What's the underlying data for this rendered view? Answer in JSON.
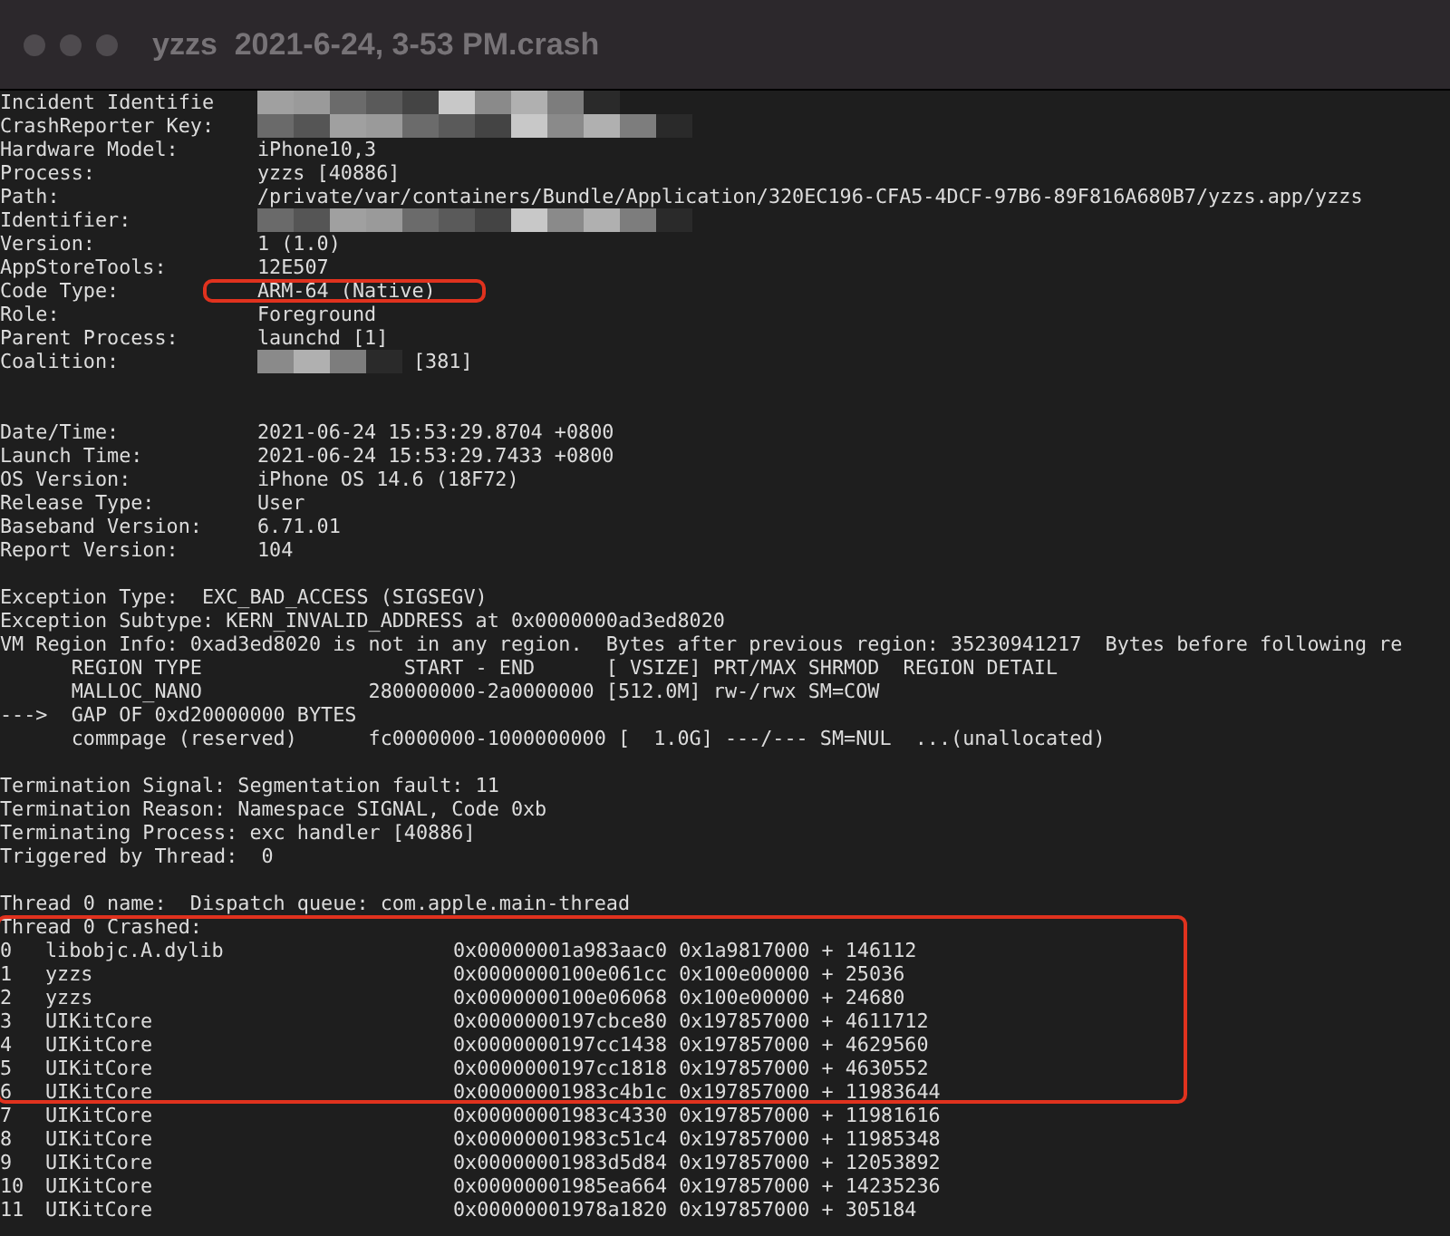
{
  "window": {
    "title": "yzzs  2021-6-24, 3-53 PM.crash"
  },
  "header_fields": [
    {
      "label": "Incident Identifie",
      "redacted": true,
      "highlighted": false
    },
    {
      "label": "CrashReporter Key:",
      "redacted": true,
      "highlighted": false
    },
    {
      "label": "Hardware Model:",
      "value": "iPhone10,3",
      "redacted": false,
      "highlighted": false
    },
    {
      "label": "Process:",
      "value": "yzzs [40886]",
      "redacted": false,
      "highlighted": false
    },
    {
      "label": "Path:",
      "value": "/private/var/containers/Bundle/Application/320EC196-CFA5-4DCF-97B6-89F816A680B7/yzzs.app/yzzs",
      "redacted": false,
      "highlighted": false
    },
    {
      "label": "Identifier:",
      "redacted": true,
      "highlighted": false
    },
    {
      "label": "Version:",
      "value": "1 (1.0)",
      "redacted": false,
      "highlighted": false
    },
    {
      "label": "AppStoreTools:",
      "value": "12E507",
      "redacted": false,
      "highlighted": false
    },
    {
      "label": "Code Type:",
      "value": "ARM-64 (Native)",
      "redacted": false,
      "highlighted": true
    },
    {
      "label": "Role:",
      "value": "Foreground",
      "redacted": false,
      "highlighted": false
    },
    {
      "label": "Parent Process:",
      "value": "launchd [1]",
      "redacted": false,
      "highlighted": false
    },
    {
      "label": "Coalition:",
      "value": "[381]",
      "redacted": true,
      "highlighted": false
    }
  ],
  "detail_fields": [
    {
      "label": "Date/Time:",
      "value": "2021-06-24 15:53:29.8704 +0800"
    },
    {
      "label": "Launch Time:",
      "value": "2021-06-24 15:53:29.7433 +0800"
    },
    {
      "label": "OS Version:",
      "value": "iPhone OS 14.6 (18F72)"
    },
    {
      "label": "Release Type:",
      "value": "User"
    },
    {
      "label": "Baseband Version:",
      "value": "6.71.01"
    },
    {
      "label": "Report Version:",
      "value": "104"
    }
  ],
  "exception_lines": [
    "Exception Type:  EXC_BAD_ACCESS (SIGSEGV)",
    "Exception Subtype: KERN_INVALID_ADDRESS at 0x0000000ad3ed8020",
    "VM Region Info: 0xad3ed8020 is not in any region.  Bytes after previous region: 35230941217  Bytes before following re",
    "      REGION TYPE                 START - END      [ VSIZE] PRT/MAX SHRMOD  REGION DETAIL",
    "      MALLOC_NANO              280000000-2a0000000 [512.0M] rw-/rwx SM=COW",
    "--->  GAP OF 0xd20000000 BYTES",
    "      commpage (reserved)      fc0000000-1000000000 [  1.0G] ---/--- SM=NUL  ...(unallocated)"
  ],
  "termination_lines": [
    "Termination Signal: Segmentation fault: 11",
    "Termination Reason: Namespace SIGNAL, Code 0xb",
    "Terminating Process: exc handler [40886]",
    "Triggered by Thread:  0"
  ],
  "thread": {
    "name_line": "Thread 0 name:  Dispatch queue: com.apple.main-thread",
    "crashed_heading": "Thread 0 Crashed:",
    "boxed_frames": [
      {
        "index": "0",
        "library": "libobjc.A.dylib",
        "address": "0x00000001a983aac0 0x1a9817000 + 146112"
      },
      {
        "index": "1",
        "library": "yzzs",
        "address": "0x0000000100e061cc 0x100e00000 + 25036"
      },
      {
        "index": "2",
        "library": "yzzs",
        "address": "0x0000000100e06068 0x100e00000 + 24680"
      },
      {
        "index": "3",
        "library": "UIKitCore",
        "address": "0x0000000197cbce80 0x197857000 + 4611712"
      },
      {
        "index": "4",
        "library": "UIKitCore",
        "address": "0x0000000197cc1438 0x197857000 + 4629560"
      },
      {
        "index": "5",
        "library": "UIKitCore",
        "address": "0x0000000197cc1818 0x197857000 + 4630552"
      },
      {
        "index": "6",
        "library": "UIKitCore",
        "address": "0x00000001983c4b1c 0x197857000 + 11983644"
      }
    ],
    "frames": [
      {
        "index": "7",
        "library": "UIKitCore",
        "address": "0x00000001983c4330 0x197857000 + 11981616"
      },
      {
        "index": "8",
        "library": "UIKitCore",
        "address": "0x00000001983c51c4 0x197857000 + 11985348"
      },
      {
        "index": "9",
        "library": "UIKitCore",
        "address": "0x00000001983d5d84 0x197857000 + 12053892"
      },
      {
        "index": "10",
        "library": "UIKitCore",
        "address": "0x00000001985ea664 0x197857000 + 14235236"
      },
      {
        "index": "11",
        "library": "UIKitCore",
        "address": "0x00000001978a1820 0x197857000 + 305184"
      }
    ]
  }
}
